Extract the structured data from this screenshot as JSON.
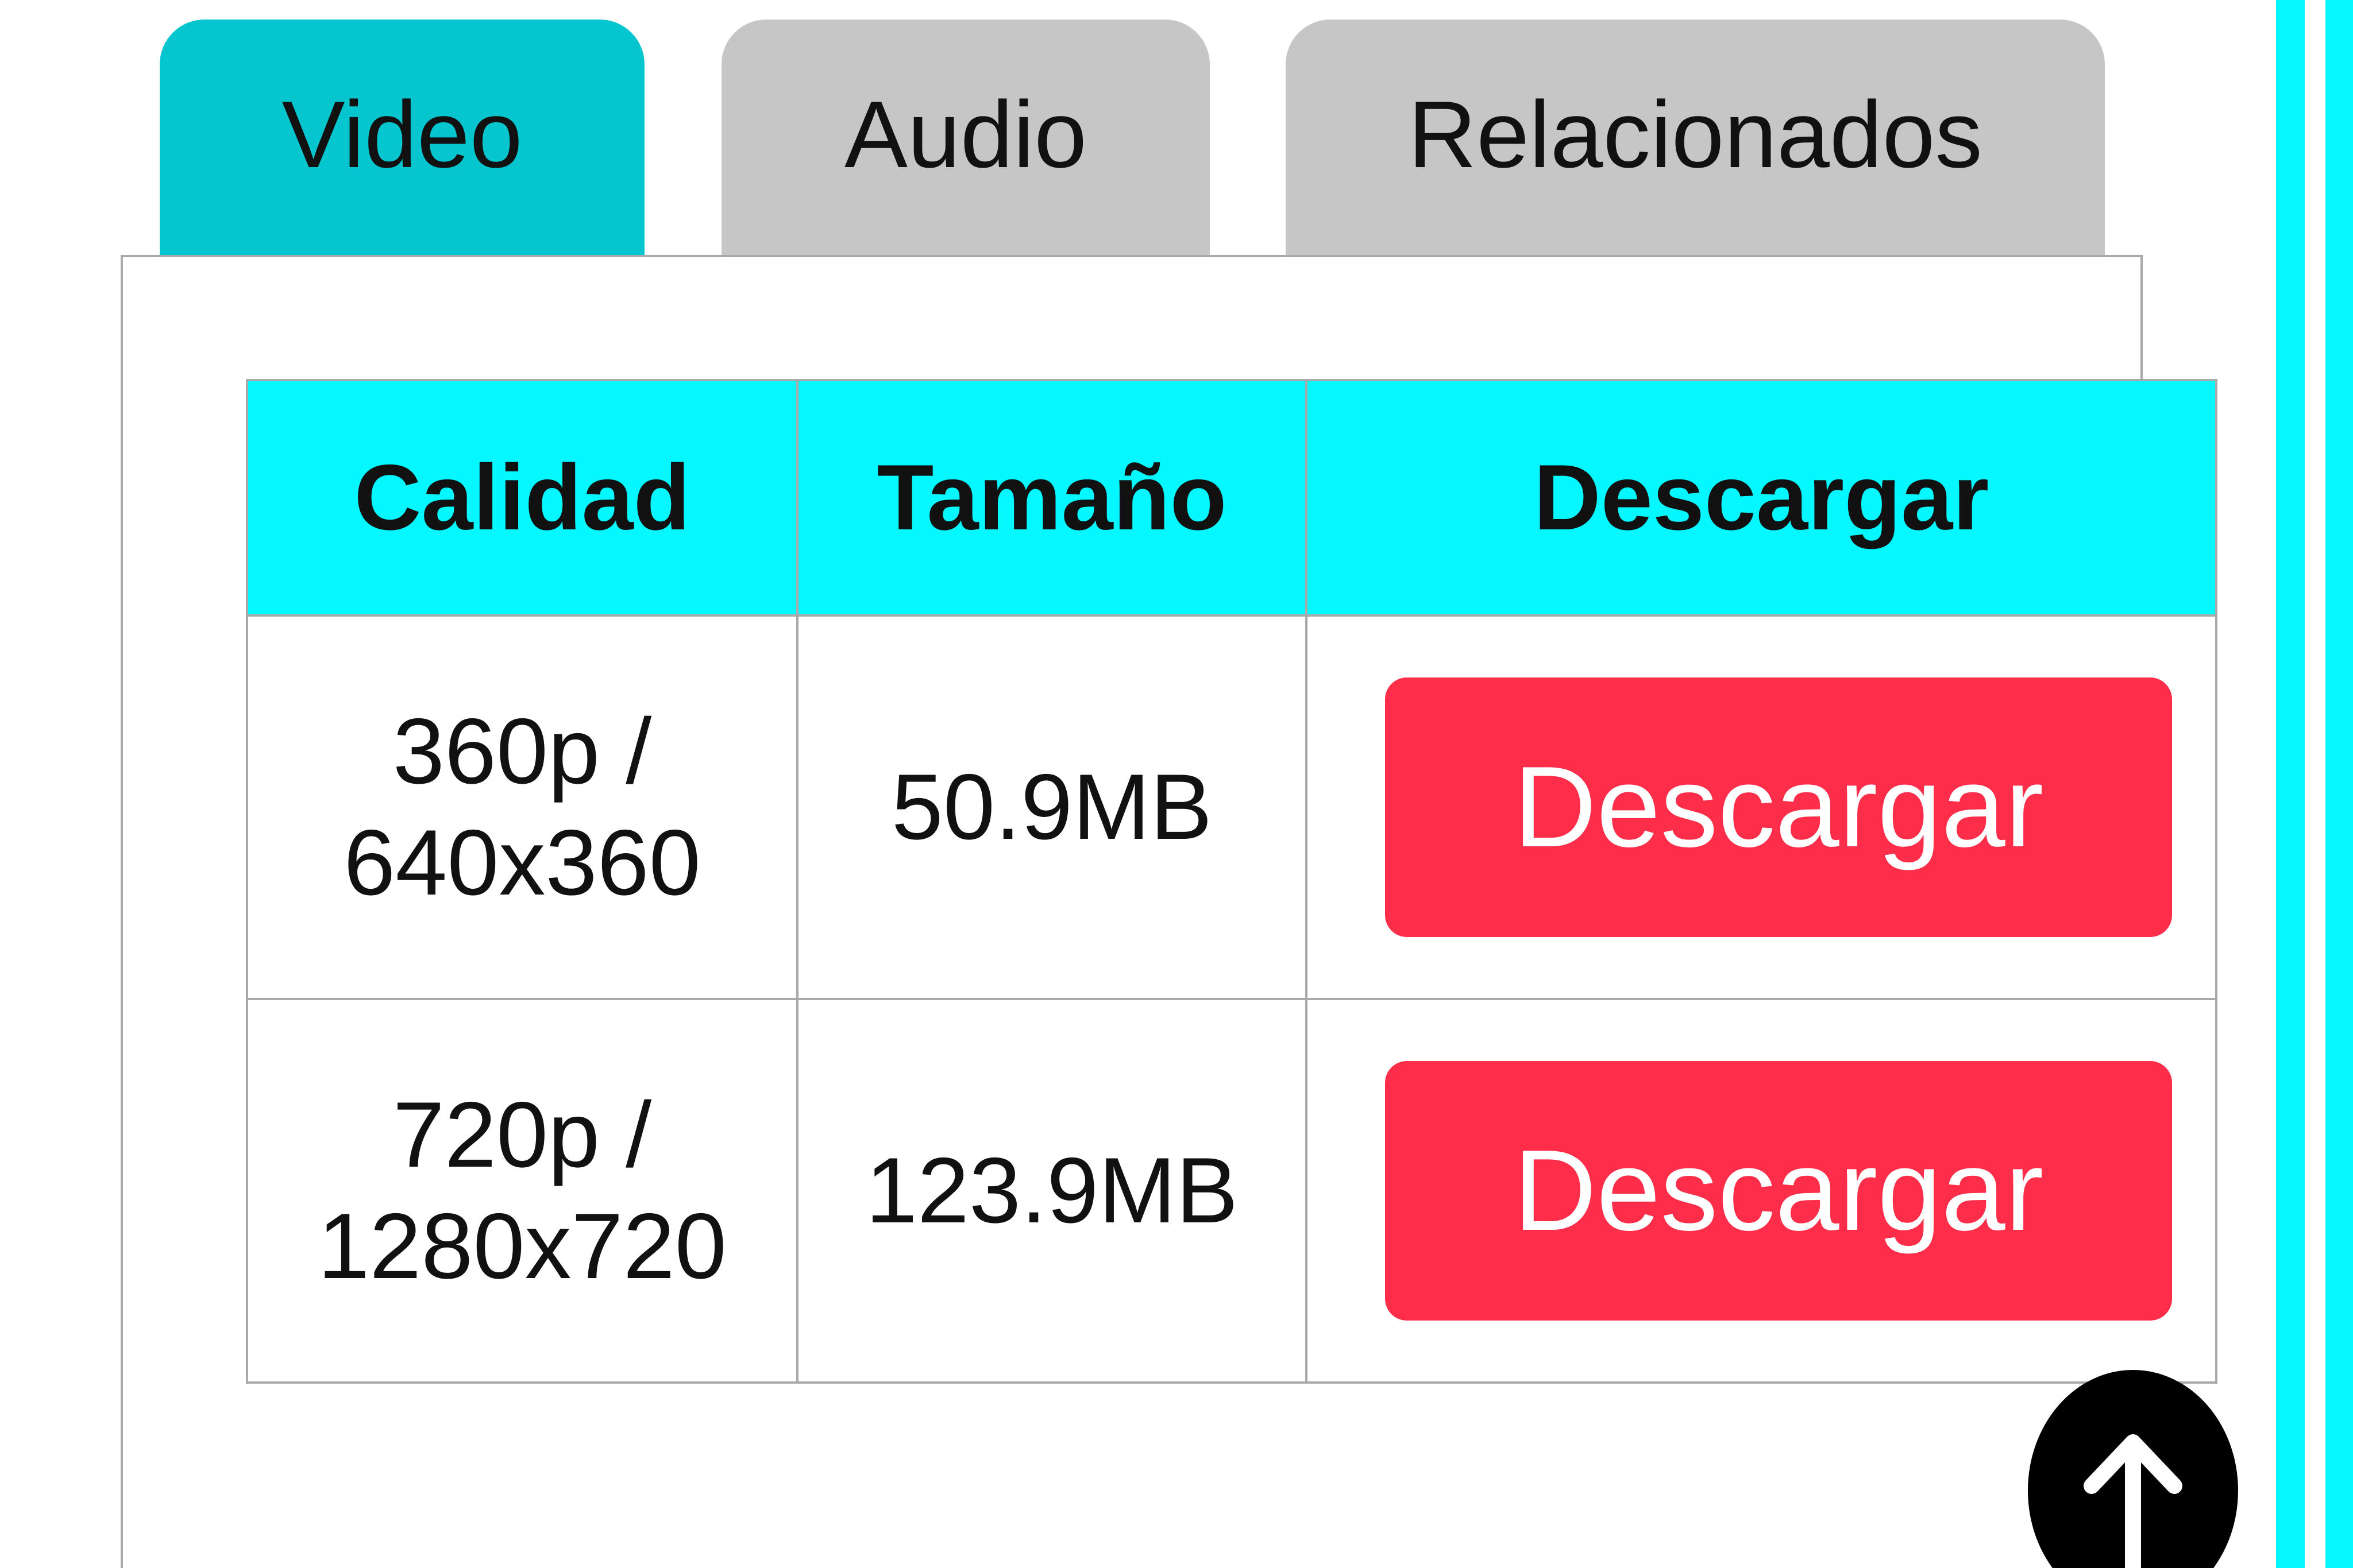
{
  "tabs": [
    {
      "label": "Video",
      "active": true
    },
    {
      "label": "Audio",
      "active": false
    },
    {
      "label": "Relacionados",
      "active": false
    }
  ],
  "table": {
    "headers": [
      "Calidad",
      "Tamaño",
      "Descargar"
    ],
    "rows": [
      {
        "quality": "360p / 640x360",
        "size": "50.9MB",
        "action_label": "Descargar"
      },
      {
        "quality": "720p / 1280x720",
        "size": "123.9MB",
        "action_label": "Descargar"
      }
    ]
  },
  "scroll_top": {
    "icon": "arrow-up-icon"
  },
  "colors": {
    "active_tab": "#05c5cf",
    "inactive_tab": "#c6c6c6",
    "header_bg": "#05f7ff",
    "download_button": "#fe2d49",
    "stripe": "#05f7ff"
  }
}
